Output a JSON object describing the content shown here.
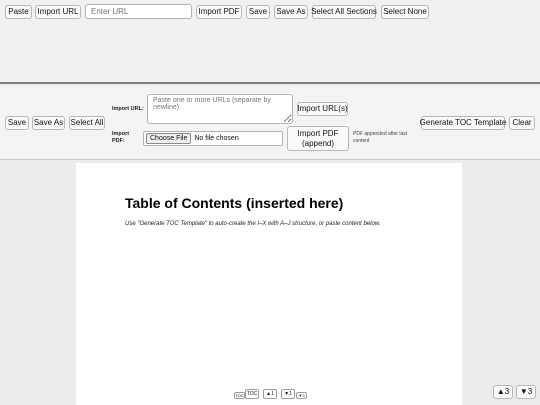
{
  "topbar": {
    "paste": "Paste",
    "import_url": "Import URL",
    "url_placeholder": "Enter URL",
    "import_pdf": "Import PDF",
    "save": "Save",
    "save_as": "Save As",
    "select_all_sections": "Select All Sections",
    "select_none": "Select None"
  },
  "toolbar": {
    "save": "Save",
    "save_as": "Save As",
    "select_all": "Select All",
    "import_url_label": "Import URL:",
    "url_textarea_placeholder": "Paste one or more URLs (separate by newline)",
    "import_urls": "Import URL(s)",
    "import_pdf_label": "Import PDF:",
    "choose_file": "Choose File",
    "no_file": "No file chosen",
    "import_pdf_append": "Import PDF (append)",
    "pdf_note": "PDF appended after last content",
    "generate_toc": "Generate TOC Template",
    "clear": "Clear"
  },
  "document": {
    "title": "Table of Contents (inserted here)",
    "hint": "Use \"Generate TOC Template\" to auto-create the I–X with A–J structure, or paste content below."
  },
  "mini_nav": {
    "toc_small": "TOC",
    "toc": "TOC",
    "up1": "▲1",
    "down1": "▼1",
    "down3_small": "▼3"
  },
  "corner_nav": {
    "up3": "▲3",
    "down3": "▼3"
  }
}
